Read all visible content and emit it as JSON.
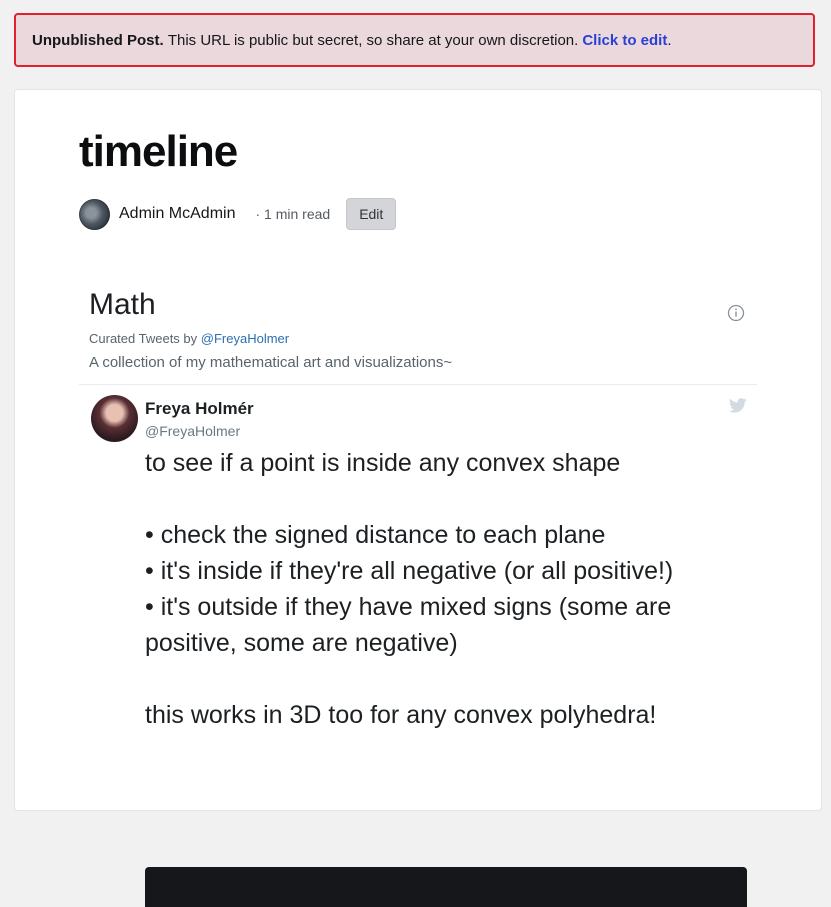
{
  "banner": {
    "strong": "Unpublished Post.",
    "message": "This URL is public but secret, so share at your own discretion.",
    "link": "Click to edit",
    "period": "."
  },
  "post": {
    "title": "timeline",
    "author": "Admin McAdmin",
    "read_time": "· 1 min read",
    "edit_label": "Edit"
  },
  "embed": {
    "collection_title": "Math",
    "curated_prefix": "Curated Tweets by",
    "curator_handle": "@FreyaHolmer",
    "description": "A collection of my mathematical art and visualizations~",
    "tweet": {
      "name": "Freya Holmér",
      "handle": "@FreyaHolmer",
      "line1": "to see if a point is inside any convex shape",
      "bullet1": "• check the signed distance to each plane",
      "bullet2": "• it's inside if they're all negative (or all positive!)",
      "bullet3": "• it's outside if they have mixed signs (some are positive, some are negative)",
      "line_last": "this works in 3D too for any convex polyhedra!"
    }
  }
}
